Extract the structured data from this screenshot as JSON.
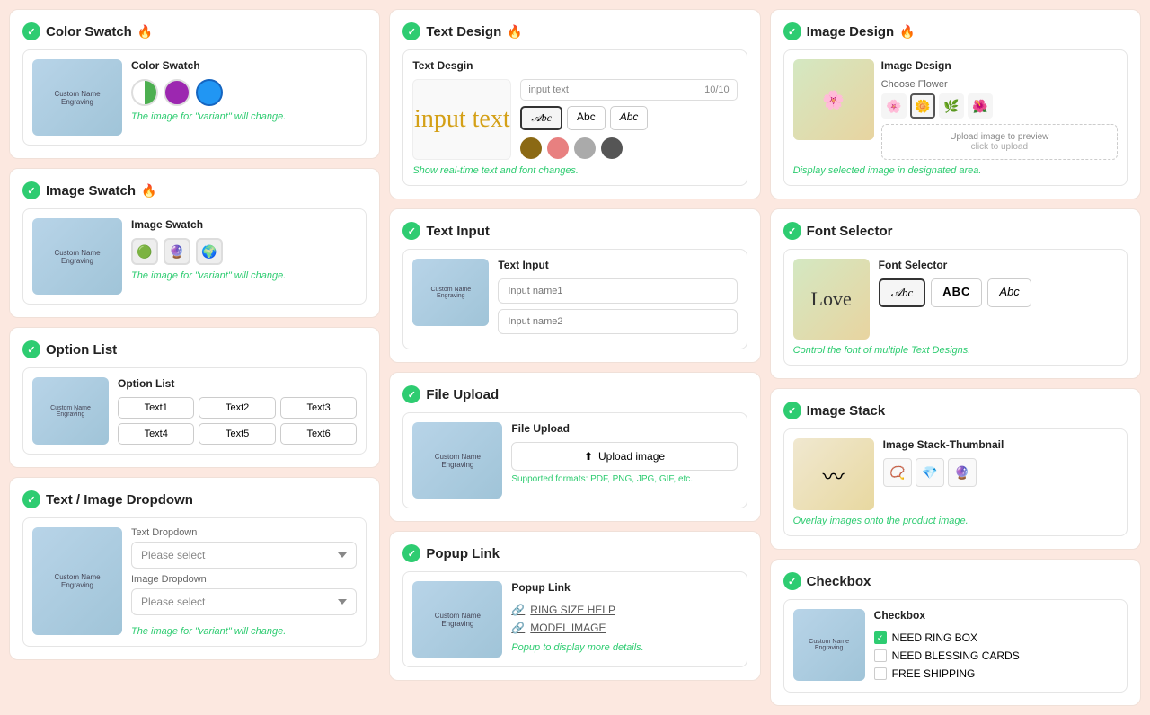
{
  "sections": {
    "colorSwatch": {
      "title": "Color Swatch",
      "fire": "🔥",
      "cardTitle": "Color Swatch",
      "variantText": "The image for \"variant\" will change.",
      "swatches": [
        {
          "type": "half",
          "label": "white-green"
        },
        {
          "type": "purple",
          "label": "purple"
        },
        {
          "type": "blue",
          "label": "blue",
          "selected": true
        }
      ]
    },
    "imageSwatch": {
      "title": "Image Swatch",
      "fire": "🔥",
      "cardTitle": "Image Swatch",
      "variantText": "The image for \"variant\" will change.",
      "swatches": [
        {
          "emoji": "🟢",
          "label": "green"
        },
        {
          "emoji": "🔮",
          "label": "purple"
        },
        {
          "emoji": "🌍",
          "label": "blue"
        }
      ]
    },
    "optionList": {
      "title": "Option List",
      "cardTitle": "Option List",
      "buttons": [
        "Text1",
        "Text2",
        "Text3",
        "Text4",
        "Text5",
        "Text6"
      ]
    },
    "textImageDropdown": {
      "title": "Text / Image Dropdown",
      "textDropdown": {
        "label": "Text Dropdown",
        "placeholder": "Please select"
      },
      "imageDropdown": {
        "label": "Image Dropdown",
        "placeholder": "Please select"
      },
      "variantText": "The image for \"variant\" will change."
    },
    "textDesign": {
      "title": "Text Design",
      "fire": "🔥",
      "cardTitle": "Text Desgin",
      "inputPlaceholder": "input text",
      "inputCount": "10/10",
      "previewText": "input text",
      "fonts": [
        "𝒜bc",
        "Abc",
        "Abc"
      ],
      "selectedFont": 0,
      "colors": [
        "#8B6914",
        "#E88080",
        "#AAAAAA",
        "#555555"
      ],
      "descText": "Show real-time text and font changes."
    },
    "textInput": {
      "title": "Text Input",
      "cardTitle": "Text  Input",
      "inputs": [
        {
          "placeholder": "Input name1"
        },
        {
          "placeholder": "Input name2"
        }
      ]
    },
    "fileUpload": {
      "title": "File Upload",
      "cardTitle": "File Upload",
      "uploadLabel": "Upload image",
      "supportText": "Supported formats: PDF, PNG, JPG, GIF, etc."
    },
    "popupLink": {
      "title": "Popup Link",
      "cardTitle": "Popup Link",
      "links": [
        {
          "icon": "🔗",
          "text": "RING SIZE HELP"
        },
        {
          "icon": "🔗",
          "text": "MODEL IMAGE"
        }
      ],
      "descText": "Popup to display more details."
    },
    "imageDesign": {
      "title": "Image Design",
      "fire": "🔥",
      "cardTitle": "Image Design",
      "chooseLabel": "Choose Flower",
      "uploadLabel": "Upload image to preview",
      "uploadSub": "click to upload",
      "descText": "Display selected image in designated area.",
      "flowers": [
        "🌸",
        "🌼",
        "🌿",
        "🌺"
      ]
    },
    "fontSelector": {
      "title": "Font Selector",
      "cardTitle": "Font Selector",
      "fonts": [
        "𝒜bc",
        "ABC",
        "Abc"
      ],
      "selectedFont": 0,
      "descText": "Control the font of multiple Text Designs.",
      "loveText": "Love"
    },
    "imageStack": {
      "title": "Image Stack",
      "cardTitle": "Image Stack-Thumbnail",
      "items": [
        "📿",
        "💎",
        "🔮"
      ],
      "descText": "Overlay images onto the product image."
    },
    "checkbox": {
      "title": "Checkbox",
      "cardTitle": "Checkbox",
      "items": [
        {
          "label": "NEED RING BOX",
          "checked": true
        },
        {
          "label": "NEED BLESSING CARDS",
          "checked": false
        },
        {
          "label": "FREE SHIPPING",
          "checked": false
        }
      ]
    }
  },
  "productImageText": "Custom Name\nEngraving"
}
